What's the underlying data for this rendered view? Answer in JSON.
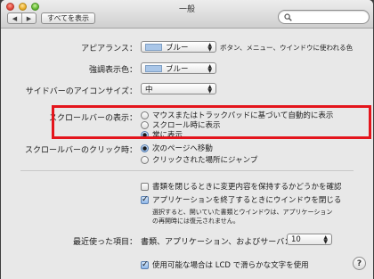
{
  "window": {
    "title": "一般"
  },
  "toolbar": {
    "show_all_label": "すべてを表示",
    "back_icon": "◀",
    "forward_icon": "▶"
  },
  "search": {
    "value": "",
    "placeholder": ""
  },
  "appearance": {
    "label": "アピアランス：",
    "value": "ブルー",
    "note": "ボタン、メニュー、ウインドウに使われる色"
  },
  "highlight": {
    "label": "強調表示色：",
    "value": "ブルー"
  },
  "sidebar_icon_size": {
    "label": "サイドバーのアイコンサイズ：",
    "value": "中"
  },
  "scrollbar_show": {
    "label": "スクロールバーの表示：",
    "options": [
      {
        "label": "マウスまたはトラックパッドに基づいて自動的に表示",
        "selected": false
      },
      {
        "label": "スクロール時に表示",
        "selected": false
      },
      {
        "label": "常に表示",
        "selected": true
      }
    ]
  },
  "scrollbar_click": {
    "label": "スクロールバーのクリック時：",
    "options": [
      {
        "label": "次のページへ移動",
        "selected": true
      },
      {
        "label": "クリックされた場所にジャンプ",
        "selected": false
      }
    ]
  },
  "documents": {
    "ask_keep_changes": {
      "label": "書類を閉じるときに変更内容を保持するかどうかを確認",
      "checked": false
    },
    "close_windows": {
      "label": "アプリケーションを終了するときにウインドウを閉じる",
      "checked": true
    },
    "close_windows_note_1": "選択すると、開いていた書類とウインドウは、アプリケーション",
    "close_windows_note_2": "の再開時には復元されません。"
  },
  "recent_items": {
    "label": "最近使った項目：",
    "suffix": "書類、アプリケーション、およびサーバ：",
    "value": "10"
  },
  "lcd_smoothing": {
    "label": "使用可能な場合は LCD で滑らかな文字を使用",
    "checked": true
  },
  "help": {
    "label": "?"
  },
  "colors": {
    "highlight_box": "#e4151c",
    "swatch_blue": "#a9c6e8"
  }
}
